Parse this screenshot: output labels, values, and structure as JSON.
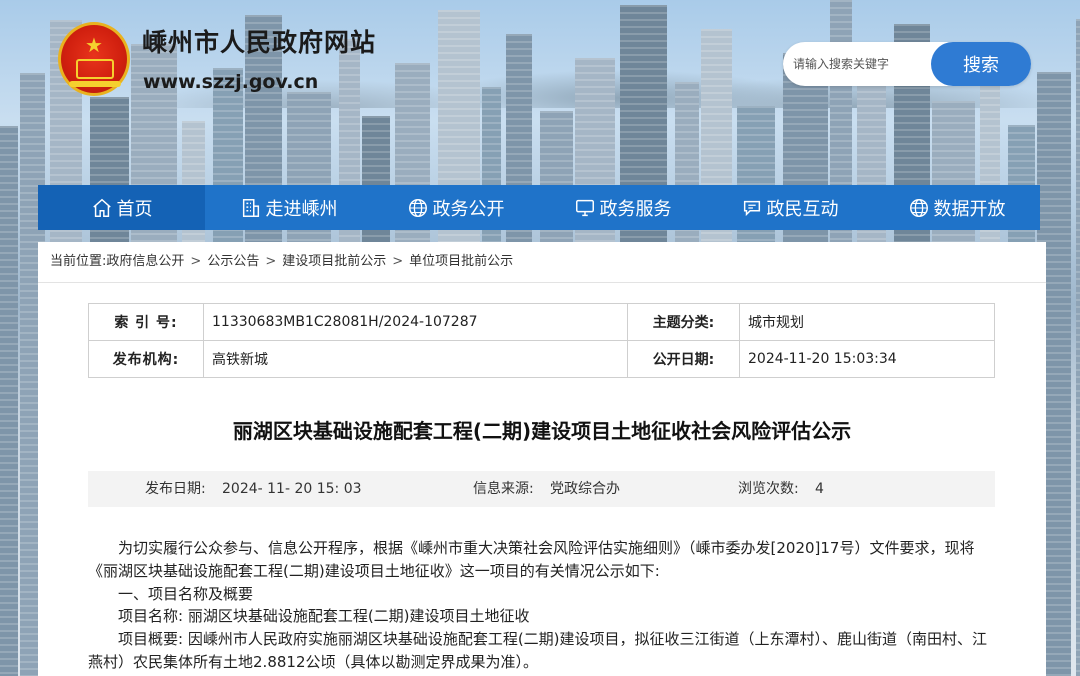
{
  "header": {
    "site_title": "嵊州市人民政府网站",
    "site_url": "www.szzj.gov.cn"
  },
  "search": {
    "placeholder": "请输入搜索关键字",
    "button_label": "搜索"
  },
  "nav": {
    "items": [
      {
        "label": "首页",
        "icon": "home-icon"
      },
      {
        "label": "走进嵊州",
        "icon": "building-icon"
      },
      {
        "label": "政务公开",
        "icon": "globe-icon"
      },
      {
        "label": "政务服务",
        "icon": "monitor-icon"
      },
      {
        "label": "政民互动",
        "icon": "chat-icon"
      },
      {
        "label": "数据开放",
        "icon": "globe-icon"
      }
    ]
  },
  "breadcrumb": {
    "prefix": "当前位置:",
    "items": [
      "政府信息公开",
      "公示公告",
      "建设项目批前公示",
      "单位项目批前公示"
    ],
    "separator": ">"
  },
  "info": {
    "index_label": "索 引 号:",
    "index_value": "11330683MB1C28081H/2024-107287",
    "category_label": "主题分类:",
    "category_value": "城市规划",
    "publisher_label": "发布机构:",
    "publisher_value": "高铁新城",
    "open_date_label": "公开日期:",
    "open_date_value": "2024-11-20 15:03:34"
  },
  "article": {
    "title": "丽湖区块基础设施配套工程(二期)建设项目土地征收社会风险评估公示",
    "publish_date_label": "发布日期:",
    "publish_date_value": "2024- 11- 20 15: 03",
    "source_label": "信息来源:",
    "source_value": "党政综合办",
    "views_label": "浏览次数:",
    "views_value": "4",
    "paragraphs": [
      "为切实履行公众参与、信息公开程序，根据《嵊州市重大决策社会风险评估实施细则》（嵊市委办发[2020]17号）文件要求，现将《丽湖区块基础设施配套工程(二期)建设项目土地征收》这一项目的有关情况公示如下:",
      "一、项目名称及概要",
      "项目名称:  丽湖区块基础设施配套工程(二期)建设项目土地征收",
      "项目概要:  因嵊州市人民政府实施丽湖区块基础设施配套工程(二期)建设项目，拟征收三江街道（上东潭村）、鹿山街道（南田村、江燕村）农民集体所有土地2.8812公顷（具体以勘测定界成果为准）。"
    ]
  },
  "colors": {
    "nav_bg": "#1f73c9",
    "nav_active": "#1462b5",
    "search_button": "#2f7bd3"
  }
}
